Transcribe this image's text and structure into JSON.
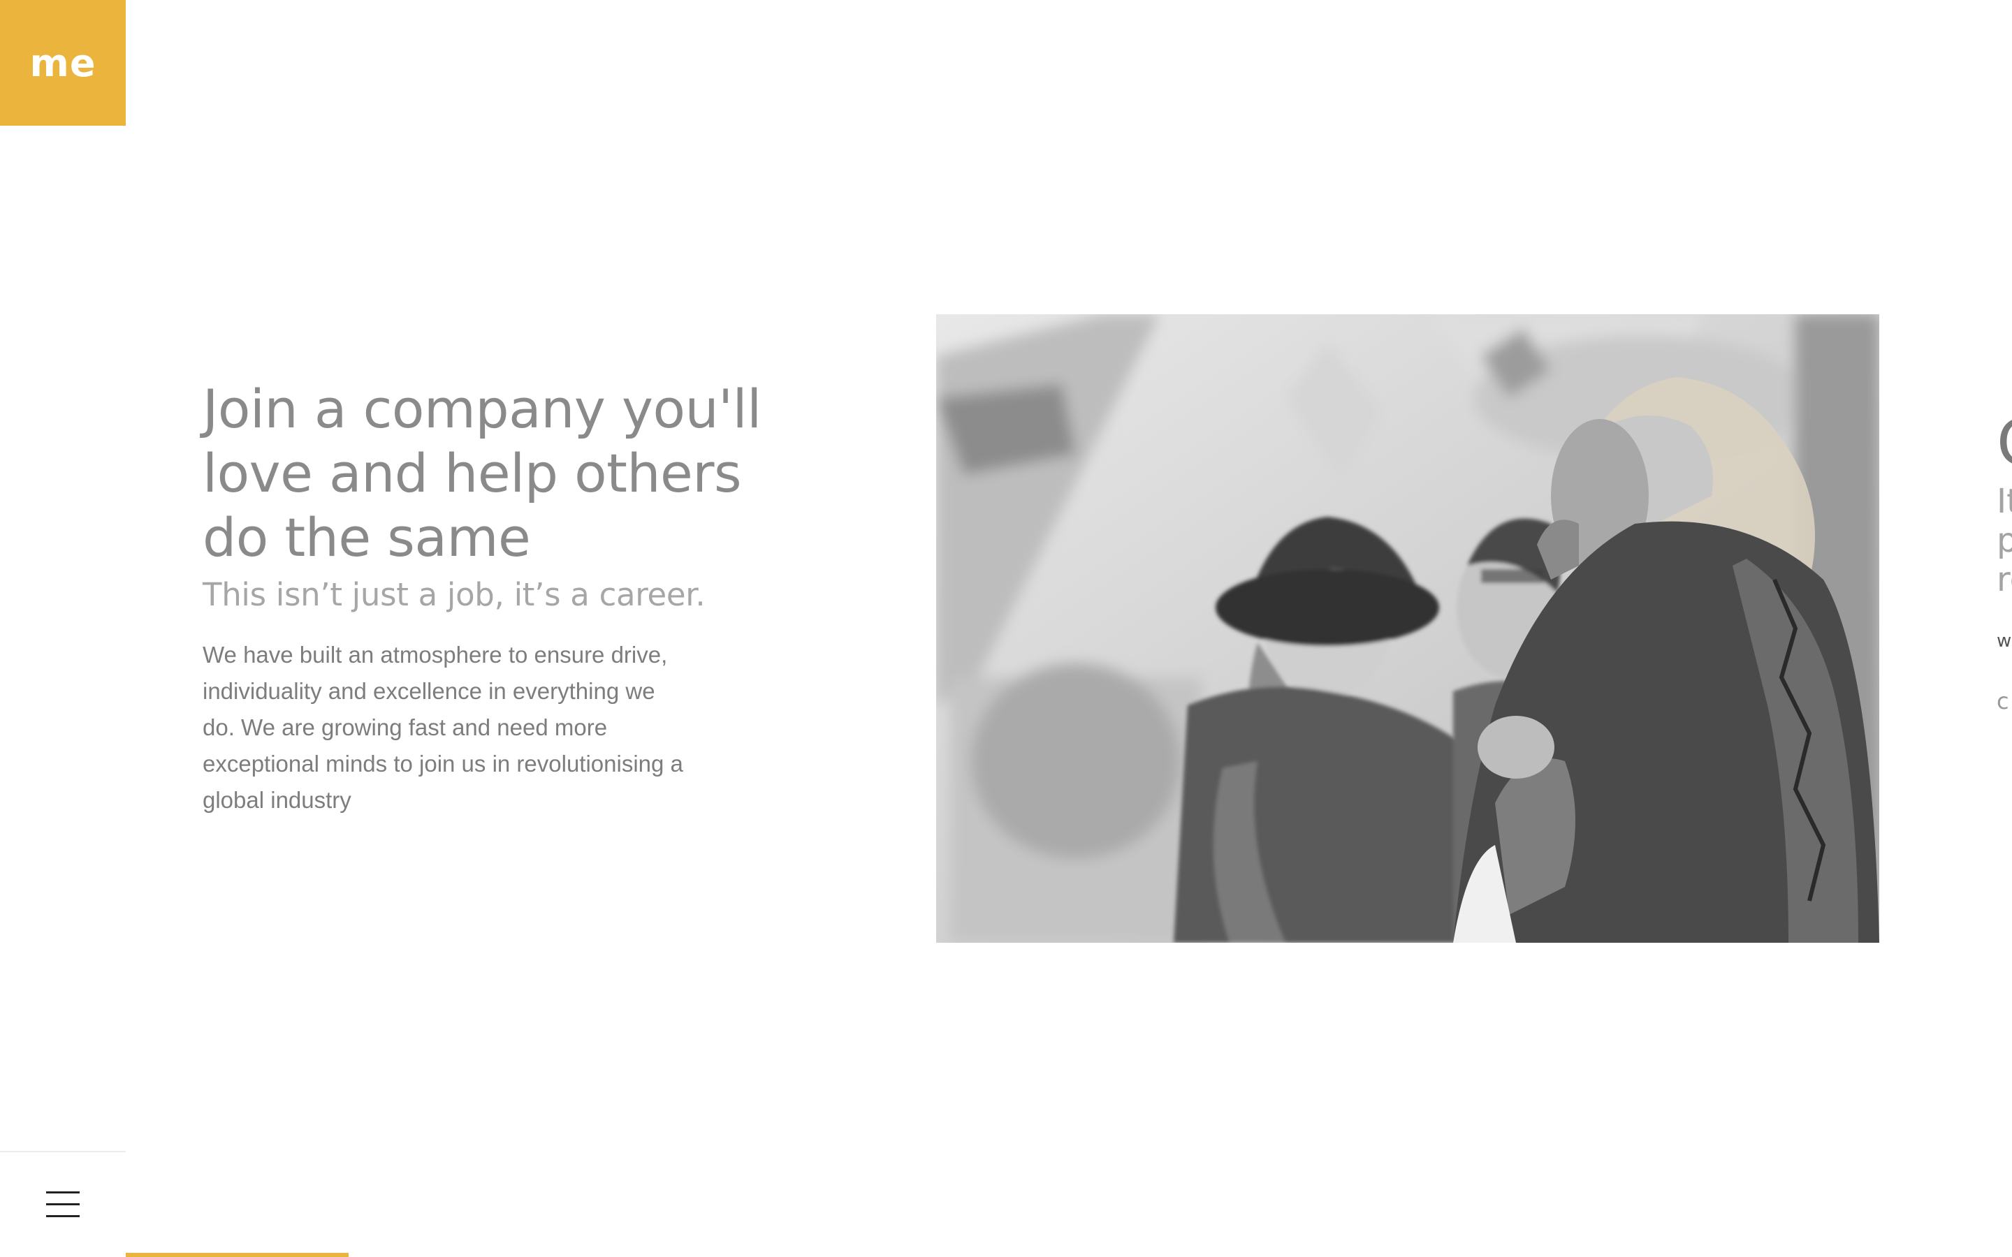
{
  "brand": {
    "logo_text": "me",
    "accent_color": "#ebb43c"
  },
  "hero": {
    "title": "Join a company you'll love and help others do the same",
    "subtitle": "This isn’t just a job, it’s a career.",
    "body": "We have built an atmosphere to ensure drive, individuality and excellence in everything we do. We are growing fast and need more exceptional minds to join us in revolutionising a global industry",
    "image_description_icon": "photo-people-laughing"
  },
  "next_slide_peek": {
    "title_fragment": "C",
    "line1": "It",
    "line2": "p",
    "line3": "re",
    "small1": "w",
    "small2": "c"
  },
  "menu": {
    "icon": "hamburger-icon"
  },
  "progress": {
    "fraction": 0.118
  }
}
